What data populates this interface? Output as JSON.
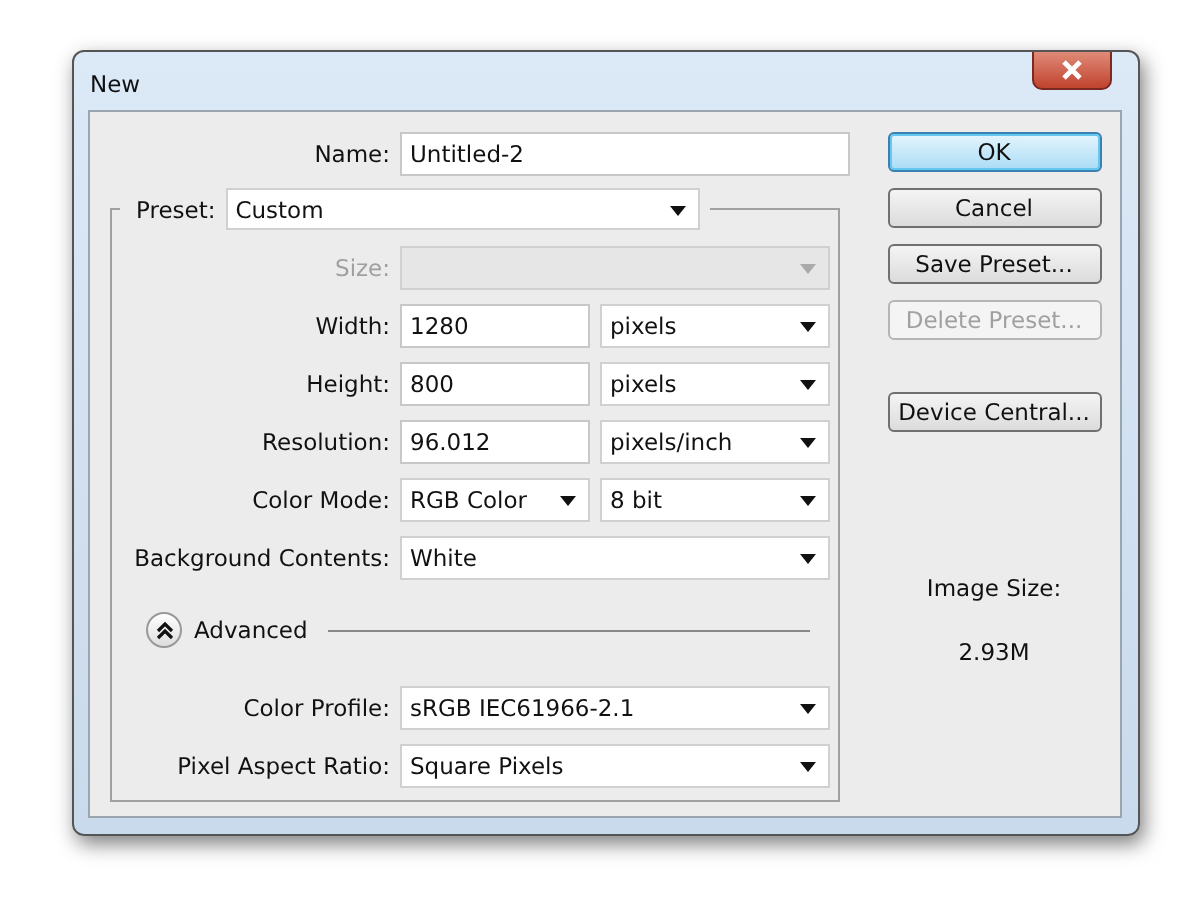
{
  "window": {
    "title": "New"
  },
  "name_field": {
    "label": "Name:",
    "value": "Untitled-2"
  },
  "preset": {
    "label": "Preset:",
    "value": "Custom"
  },
  "rows": [
    {
      "kind": "select",
      "label": "Size:",
      "disabled": true
    },
    {
      "kind": "input_select",
      "label": "Width:",
      "value": "1280",
      "unit": "pixels",
      "disabled": false
    },
    {
      "kind": "input_select",
      "label": "Height:",
      "value": "800",
      "unit": "pixels",
      "disabled": false
    },
    {
      "kind": "input_select",
      "label": "Resolution:",
      "value": "96.012",
      "unit": "pixels/inch",
      "disabled": false
    },
    {
      "kind": "select_pair",
      "label": "Color Mode:",
      "value": "RGB Color",
      "unit": "8 bit",
      "disabled": false
    },
    {
      "kind": "select",
      "label": "Background Contents:",
      "value": "White",
      "disabled": false
    }
  ],
  "advanced": {
    "label": "Advanced",
    "expanded": true,
    "rows": [
      {
        "kind": "select",
        "label": "Color Profile:",
        "value": "sRGB IEC61966-2.1",
        "disabled": false
      },
      {
        "kind": "select",
        "label": "Pixel Aspect Ratio:",
        "value": "Square Pixels",
        "disabled": false
      }
    ]
  },
  "buttons": [
    {
      "label": "OK",
      "default": true,
      "disabled": false
    },
    {
      "label": "Cancel",
      "default": false,
      "disabled": false
    },
    {
      "label": "Save Preset...",
      "default": false,
      "disabled": false
    },
    {
      "label": "Delete Preset...",
      "default": false,
      "disabled": true
    },
    {
      "label": "Device Central...",
      "default": false,
      "disabled": false
    }
  ],
  "image_size": {
    "label": "Image Size:",
    "value": "2.93M"
  }
}
